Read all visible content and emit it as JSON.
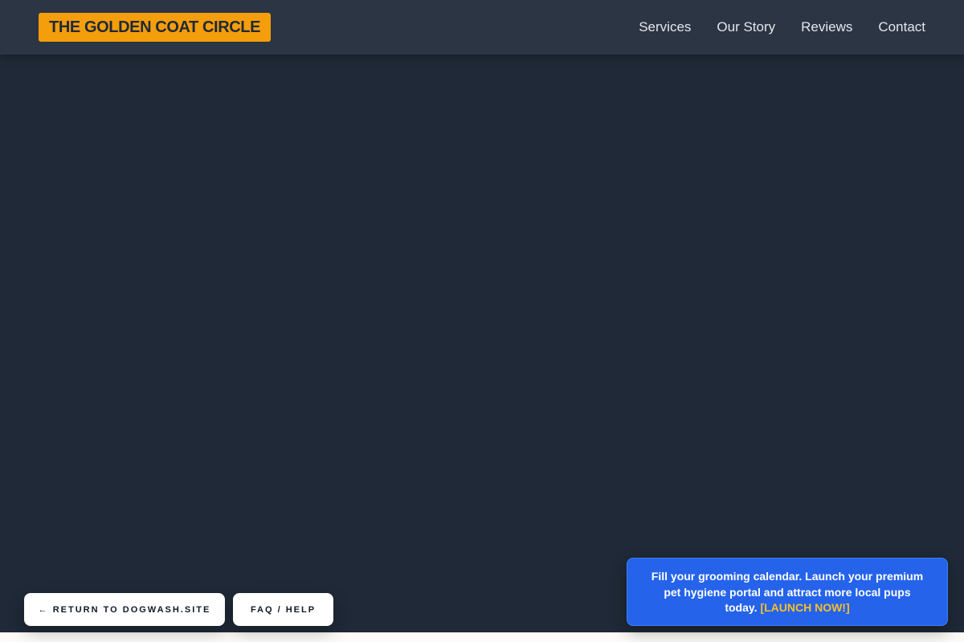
{
  "header": {
    "logo": "THE GOLDEN COAT CIRCLE",
    "nav": [
      {
        "label": "Services"
      },
      {
        "label": "Our Story"
      },
      {
        "label": "Reviews"
      },
      {
        "label": "Contact"
      }
    ]
  },
  "footer_buttons": {
    "return_label": "← RETURN TO DOGWASH.SITE",
    "faq_label": "FAQ / HELP"
  },
  "promo": {
    "text": "Fill your grooming calendar. Launch your premium pet hygiene portal and attract more local pups today.",
    "link_label": "[LAUNCH NOW!]"
  },
  "colors": {
    "page_background": "#1f2937",
    "header_background": "#2b3544",
    "logo_background": "#f59e0b",
    "promo_background": "#2563eb",
    "promo_link": "#fbbf24"
  }
}
